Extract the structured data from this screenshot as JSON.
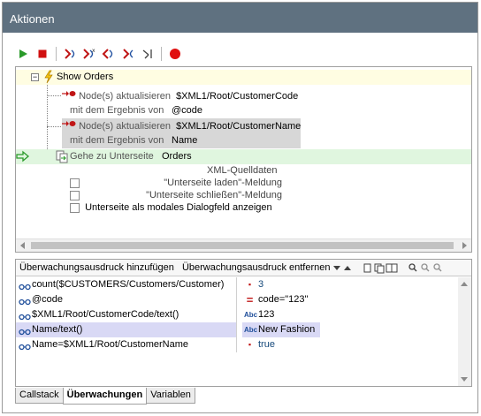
{
  "window": {
    "title": "Aktionen"
  },
  "toolbar": {
    "buttons": [
      "run-icon",
      "stop-icon",
      "step-into-icon",
      "step-over-icon",
      "step-out-icon",
      "step-back-icon",
      "run-to-cursor-icon",
      "breakpoint-icon"
    ],
    "accent_green": "#2a9a2a",
    "accent_red": "#d01010"
  },
  "tree": {
    "root_label": "Show Orders",
    "action1": {
      "verb": "Node(s) aktualisieren",
      "target": "$XML1/Root/CustomerCode",
      "result_prefix": "mit dem Ergebnis von",
      "result": "@code"
    },
    "action2": {
      "verb": "Node(s) aktualisieren",
      "target": "$XML1/Root/CustomerName",
      "result_prefix": "mit dem Ergebnis von",
      "result": "Name"
    },
    "goto": {
      "verb": "Gehe zu Unterseite",
      "target": "Orders"
    },
    "opts": {
      "xml_source": "XML-Quelldaten",
      "load_msg": "\"Unterseite laden\"-Meldung",
      "close_msg": "\"Unterseite schließen\"-Meldung",
      "modal": "Unterseite als modales Dialogfeld anzeigen"
    }
  },
  "watch": {
    "add_label": "Überwachungsausdruck hinzufügen",
    "remove_label": "Überwachungsausdruck entfernen",
    "rows": [
      {
        "expr": "count($CUSTOMERS/Customers/Customer)",
        "type": "▪",
        "value": "3"
      },
      {
        "expr": "@code",
        "type": "=",
        "value": "code=\"123\""
      },
      {
        "expr": "$XML1/Root/CustomerCode/text()",
        "type": "Abc",
        "value": "123"
      },
      {
        "expr": "Name/text()",
        "type": "Abc",
        "value": "New Fashion"
      },
      {
        "expr": "Name=$XML1/Root/CustomerName",
        "type": "▪",
        "value": "true"
      }
    ]
  },
  "tabs": [
    "Callstack",
    "Überwachungen",
    "Variablen"
  ]
}
